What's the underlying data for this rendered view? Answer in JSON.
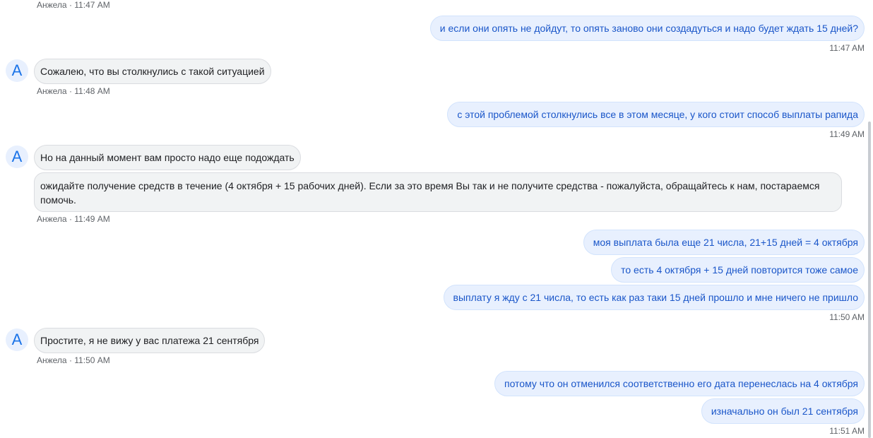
{
  "messages": {
    "m0_meta": "Анжела · 11:47 AM",
    "m1": "и если они опять не дойдут, то опять заново они создадуться и надо будет ждать 15 дней?",
    "m1_time": "11:47 AM",
    "m2_avatar": "A",
    "m2": "Сожалею, что вы столкнулись с такой ситуацией",
    "m2_meta": "Анжела · 11:48 AM",
    "m3": "с этой проблемой столкнулись все в этом месяце, у кого стоит способ выплаты рапида",
    "m3_time": "11:49 AM",
    "m4_avatar": "A",
    "m4a": "Но на данный момент вам просто надо еще подождать",
    "m4b": "ожидайте получение средств в течение (4 октября + 15 рабочих дней). Если за это время Вы так и не получите средства - пожалуйста, обращайтесь к нам, постараемся помочь.",
    "m4_meta": "Анжела · 11:49 AM",
    "m5a": "моя выплата была еще 21 числа, 21+15 дней = 4 октября",
    "m5b": "то есть 4 октября + 15 дней повторится тоже самое",
    "m5c": "выплату я жду с 21 числа, то есть как раз таки 15 дней прошло и мне ничего не пришло",
    "m5_time": "11:50 AM",
    "m6_avatar": "A",
    "m6": "Простите, я не вижу у вас платежа 21 сентября",
    "m6_meta": "Анжела · 11:50 AM",
    "m7a": "потому что он отменился соответственно его дата перенеслась на 4 октября",
    "m7b": "изначально он был 21 сентября",
    "m7_time": "11:51 AM"
  }
}
